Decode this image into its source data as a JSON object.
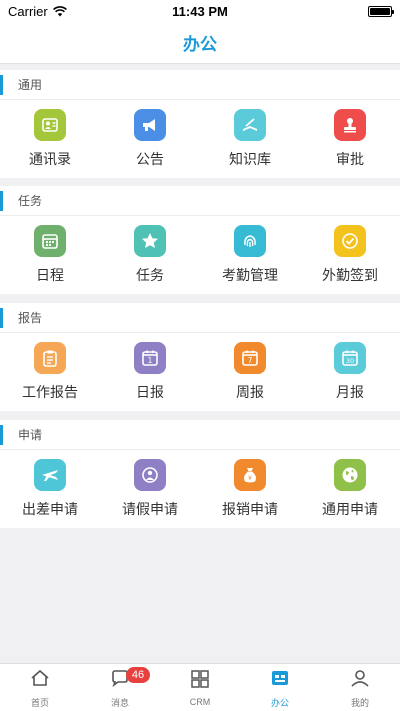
{
  "status_bar": {
    "carrier": "Carrier",
    "time": "11:43 PM"
  },
  "nav": {
    "title": "办公"
  },
  "sections": [
    {
      "title": "通用",
      "items": [
        {
          "label": "通讯录",
          "icon": "contacts-icon",
          "color": "#a3c63b"
        },
        {
          "label": "公告",
          "icon": "megaphone-icon",
          "color": "#4a8ee6"
        },
        {
          "label": "知识库",
          "icon": "book-icon",
          "color": "#5ccbd9"
        },
        {
          "label": "审批",
          "icon": "stamp-icon",
          "color": "#ef4c4c"
        }
      ]
    },
    {
      "title": "任务",
      "items": [
        {
          "label": "日程",
          "icon": "calendar-icon",
          "color": "#6fb06d"
        },
        {
          "label": "任务",
          "icon": "star-icon",
          "color": "#4fc2b5"
        },
        {
          "label": "考勤管理",
          "icon": "fingerprint-icon",
          "color": "#37bad4"
        },
        {
          "label": "外勤签到",
          "icon": "checkin-icon",
          "color": "#f3c21d"
        }
      ]
    },
    {
      "title": "报告",
      "items": [
        {
          "label": "工作报告",
          "icon": "clipboard-icon",
          "color": "#f5a755"
        },
        {
          "label": "日报",
          "icon": "calendar-1-icon",
          "color": "#8f7fc4",
          "num": "1"
        },
        {
          "label": "周报",
          "icon": "calendar-7-icon",
          "color": "#f08a2c",
          "num": "7"
        },
        {
          "label": "月报",
          "icon": "calendar-30-icon",
          "color": "#5ccbd9",
          "num": "30"
        }
      ]
    },
    {
      "title": "申请",
      "items": [
        {
          "label": "出差申请",
          "icon": "airplane-icon",
          "color": "#4fc6d7"
        },
        {
          "label": "请假申请",
          "icon": "leave-icon",
          "color": "#8f7fc4"
        },
        {
          "label": "报销申请",
          "icon": "money-bag-icon",
          "color": "#f08a2c"
        },
        {
          "label": "通用申请",
          "icon": "globe-icon",
          "color": "#8fc04a"
        }
      ]
    }
  ],
  "tabs": [
    {
      "label": "首页",
      "icon": "home-icon"
    },
    {
      "label": "消息",
      "icon": "chat-icon",
      "badge": "46"
    },
    {
      "label": "CRM",
      "icon": "crm-icon"
    },
    {
      "label": "办公",
      "icon": "office-icon",
      "active": true
    },
    {
      "label": "我的",
      "icon": "profile-icon"
    }
  ],
  "colors": {
    "accent": "#1a9bd7",
    "badge": "#e8403f"
  }
}
